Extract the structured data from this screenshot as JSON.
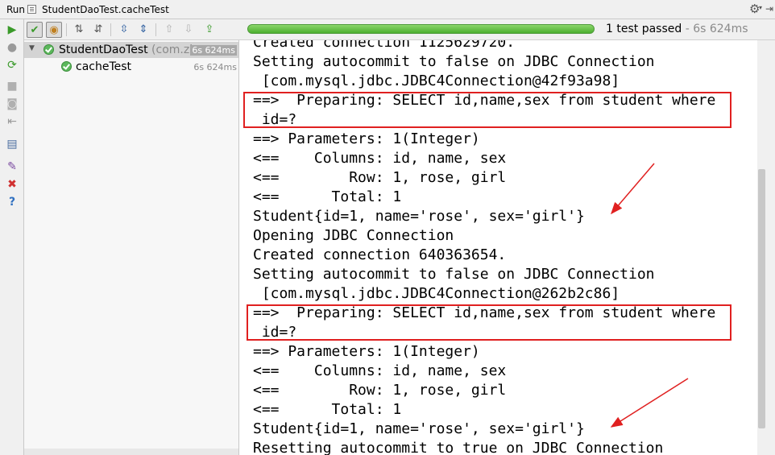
{
  "titlebar": {
    "run_label": "Run",
    "tab_title": "StudentDaoTest.cacheTest"
  },
  "status": {
    "result": "1 test passed",
    "separator": " - ",
    "duration": "6s 624ms",
    "progress_percent": 100
  },
  "tree": {
    "suite": {
      "name": "StudentDaoTest",
      "package": " (com.zh",
      "time": "6s 624ms"
    },
    "test": {
      "name": "cacheTest",
      "time": "6s 624ms"
    }
  },
  "console": {
    "lines": [
      "Created connection 1125629720.",
      "Setting autocommit to false on JDBC Connection",
      " [com.mysql.jdbc.JDBC4Connection@42f93a98]",
      "==>  Preparing: SELECT id,name,sex from student where",
      " id=?",
      "==> Parameters: 1(Integer)",
      "<==    Columns: id, name, sex",
      "<==        Row: 1, rose, girl",
      "<==      Total: 1",
      "Student{id=1, name='rose', sex='girl'}",
      "Opening JDBC Connection",
      "Created connection 640363654.",
      "Setting autocommit to false on JDBC Connection",
      " [com.mysql.jdbc.JDBC4Connection@262b2c86]",
      "==>  Preparing: SELECT id,name,sex from student where",
      " id=?",
      "==> Parameters: 1(Integer)",
      "<==    Columns: id, name, sex",
      "<==        Row: 1, rose, girl",
      "<==      Total: 1",
      "Student{id=1, name='rose', sex='girl'}",
      "Resetting autocommit to true on JDBC Connection"
    ]
  },
  "icons": {
    "left_toolbar": [
      "run-icon",
      "debug-icon",
      "rerun-failed-icon",
      "stop-icon",
      "screenshot-icon",
      "exit-icon",
      "layout-icon",
      "pin-icon",
      "close-icon",
      "help-icon"
    ],
    "top_toolbar": [
      "show-passed-icon",
      "show-ignored-icon",
      "sort-alpha-icon",
      "sort-duration-icon",
      "expand-all-icon",
      "collapse-all-icon",
      "previous-test-icon",
      "next-test-icon",
      "export-icon"
    ]
  },
  "colors": {
    "highlight_box": "#e02020",
    "annotation_arrow": "#e02020",
    "progress": "#5cb85c",
    "pass_icon": "#5cb85c"
  }
}
